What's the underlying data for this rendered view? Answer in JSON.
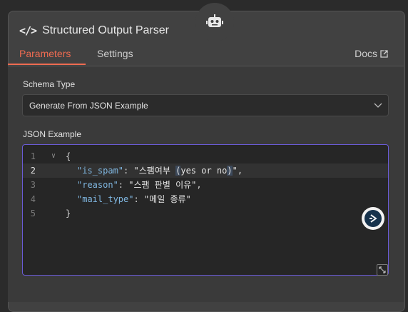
{
  "header": {
    "title": "Structured Output Parser",
    "icon": "code-icon",
    "badge_icon": "robot-icon"
  },
  "tabs": [
    {
      "label": "Parameters",
      "active": true
    },
    {
      "label": "Settings",
      "active": false
    }
  ],
  "docs": {
    "label": "Docs",
    "icon": "external-link-icon"
  },
  "schema_type": {
    "label": "Schema Type",
    "value": "Generate From JSON Example"
  },
  "json_example": {
    "label": "JSON Example",
    "line_numbers": [
      "1",
      "2",
      "3",
      "4",
      "5"
    ],
    "lines": [
      "{",
      "\"is_spam\": \"스팸여부 (yes or no)\",",
      "\"reason\": \"스팸 판별 이유\",",
      "\"mail_type\": \"메일 종류\"",
      "}"
    ],
    "active_line": 2
  },
  "colors": {
    "accent": "#ef6b51",
    "editor_border": "#6a5bd6",
    "json_key": "#7fb6e0"
  }
}
